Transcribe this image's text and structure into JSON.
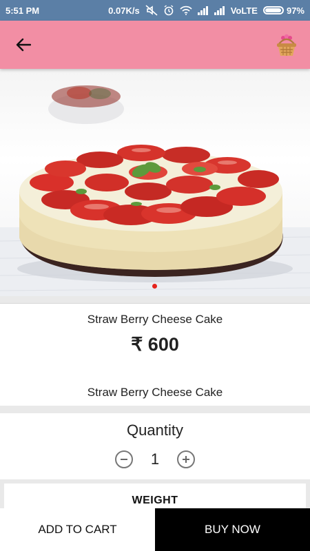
{
  "status_bar": {
    "time": "5:51 PM",
    "network_speed": "0.07K/s",
    "carrier": "VoLTE",
    "battery": "97%",
    "battery_level": 0.97,
    "icons": [
      "mute-icon",
      "alarm-icon",
      "wifi-icon",
      "signal-icon",
      "signal-icon",
      "battery-icon"
    ]
  },
  "app_bar": {
    "background": "#f28ea4",
    "back_icon": "arrow-left-icon",
    "cart_icon": "basket-icon"
  },
  "product": {
    "image": "strawberry-cheesecake-photo",
    "carousel_active_index": 0,
    "carousel_dot_color": "#e5231c",
    "name": "Straw Berry Cheese Cake",
    "price": "₹ 600",
    "description": "Straw Berry Cheese Cake"
  },
  "quantity": {
    "label": "Quantity",
    "value": "1",
    "decrement_icon": "minus-circle-icon",
    "increment_icon": "plus-circle-icon"
  },
  "weight": {
    "label": "WEIGHT"
  },
  "actions": {
    "add_to_cart": "ADD TO CART",
    "buy_now": "BUY NOW"
  }
}
